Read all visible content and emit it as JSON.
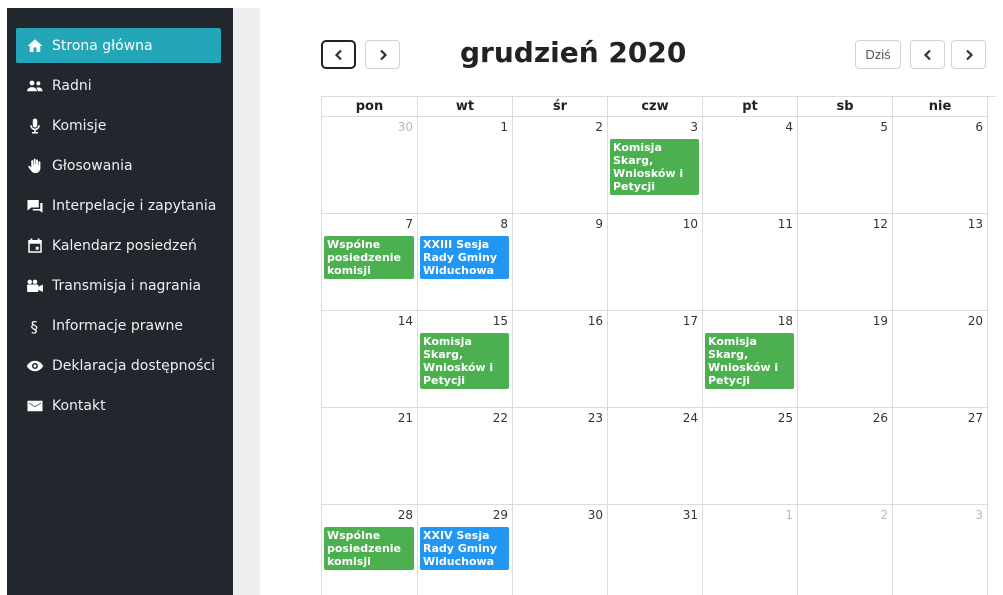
{
  "sidebar": {
    "items": [
      {
        "label": "Strona główna",
        "icon": "home-icon",
        "active": true
      },
      {
        "label": "Radni",
        "icon": "users-icon"
      },
      {
        "label": "Komisje",
        "icon": "microphone-icon"
      },
      {
        "label": "Głosowania",
        "icon": "hand-icon"
      },
      {
        "label": "Interpelacje i zapytania",
        "icon": "chat-icon"
      },
      {
        "label": "Kalendarz posiedzeń",
        "icon": "calendar-icon"
      },
      {
        "label": "Transmisja i nagrania",
        "icon": "video-camera-icon"
      },
      {
        "label": "Informacje prawne",
        "icon": "paragraph-icon"
      },
      {
        "label": "Deklaracja dostępności",
        "icon": "eye-icon"
      },
      {
        "label": "Kontakt",
        "icon": "envelope-icon"
      }
    ]
  },
  "calendar": {
    "title": "grudzień 2020",
    "today_label": "Dziś",
    "weekdays": [
      "pon",
      "wt",
      "śr",
      "czw",
      "pt",
      "sb",
      "nie"
    ],
    "weeks": [
      [
        {
          "day": "30",
          "other": true
        },
        {
          "day": "1"
        },
        {
          "day": "2"
        },
        {
          "day": "3",
          "event": {
            "title": "Komisja Skarg, Wniosków i Petycji",
            "color": "green"
          }
        },
        {
          "day": "4"
        },
        {
          "day": "5"
        },
        {
          "day": "6"
        }
      ],
      [
        {
          "day": "7",
          "event": {
            "title": "Wspólne posiedzenie komisji",
            "color": "green"
          }
        },
        {
          "day": "8",
          "event": {
            "title": "XXIII Sesja Rady Gminy Widuchowa",
            "color": "blue"
          }
        },
        {
          "day": "9"
        },
        {
          "day": "10"
        },
        {
          "day": "11"
        },
        {
          "day": "12"
        },
        {
          "day": "13"
        }
      ],
      [
        {
          "day": "14"
        },
        {
          "day": "15",
          "event": {
            "title": "Komisja Skarg, Wniosków i Petycji",
            "color": "green"
          }
        },
        {
          "day": "16"
        },
        {
          "day": "17"
        },
        {
          "day": "18",
          "event": {
            "title": "Komisja Skarg, Wniosków i Petycji",
            "color": "green"
          }
        },
        {
          "day": "19"
        },
        {
          "day": "20"
        }
      ],
      [
        {
          "day": "21"
        },
        {
          "day": "22"
        },
        {
          "day": "23"
        },
        {
          "day": "24"
        },
        {
          "day": "25"
        },
        {
          "day": "26"
        },
        {
          "day": "27"
        }
      ],
      [
        {
          "day": "28",
          "event": {
            "title": "Wspólne posiedzenie komisji",
            "color": "green"
          }
        },
        {
          "day": "29",
          "event": {
            "title": "XXIV Sesja Rady Gminy Widuchowa",
            "color": "blue"
          }
        },
        {
          "day": "30"
        },
        {
          "day": "31"
        },
        {
          "day": "1",
          "other": true
        },
        {
          "day": "2",
          "other": true
        },
        {
          "day": "3",
          "other": true
        }
      ]
    ]
  },
  "colors": {
    "sidebar_bg": "#22272e",
    "active_item": "#22a6b8",
    "event_green": "#4caf50",
    "event_blue": "#2196f3"
  }
}
